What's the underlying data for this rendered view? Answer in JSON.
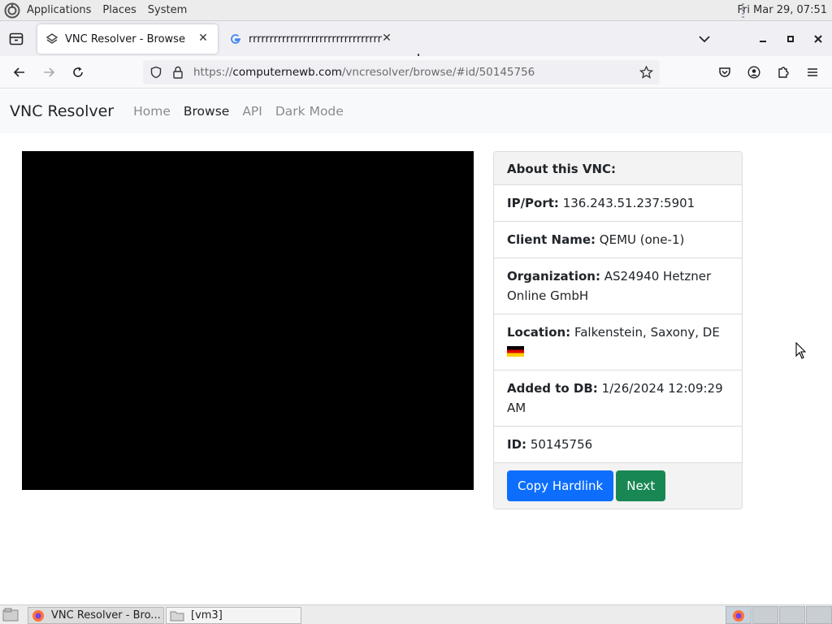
{
  "top_panel": {
    "menus": [
      "Applications",
      "Places",
      "System"
    ],
    "clock": "Fri Mar 29, 07:51"
  },
  "browser": {
    "tabs": [
      {
        "title": "VNC Resolver - Browse",
        "active": true,
        "favicon": "vnc-favicon-icon"
      },
      {
        "title": "rrrrrrrrrrrrrrrrrrrrrrrrrrrrrrrrrrrr",
        "active": false,
        "favicon": "google-favicon-icon"
      }
    ],
    "url_host": "computernewb.com",
    "url_path": "/vncresolver/browse/#id/50145756",
    "url_prefix": "https://"
  },
  "site": {
    "brand": "VNC Resolver",
    "nav": [
      "Home",
      "Browse",
      "API",
      "Dark Mode"
    ],
    "active_nav": "Browse"
  },
  "info": {
    "header": "About this VNC:",
    "ip_label": "IP/Port:",
    "ip_value": "136.243.51.237:5901",
    "client_label": "Client Name:",
    "client_value": "QEMU (one-1)",
    "org_label": "Organization:",
    "org_value": "AS24940 Hetzner Online GmbH",
    "location_label": "Location:",
    "location_value": "Falkenstein, Saxony, DE",
    "added_label": "Added to DB:",
    "added_value": "1/26/2024 12:09:29 AM",
    "id_label": "ID:",
    "id_value": "50145756",
    "copy_button": "Copy Hardlink",
    "next_button": "Next"
  },
  "taskbar": {
    "tasks": [
      "VNC Resolver - Bro...",
      "[vm3]"
    ]
  },
  "colors": {
    "primary": "#0d6efd",
    "success": "#198754",
    "navbar_bg": "#f8f9fa"
  }
}
